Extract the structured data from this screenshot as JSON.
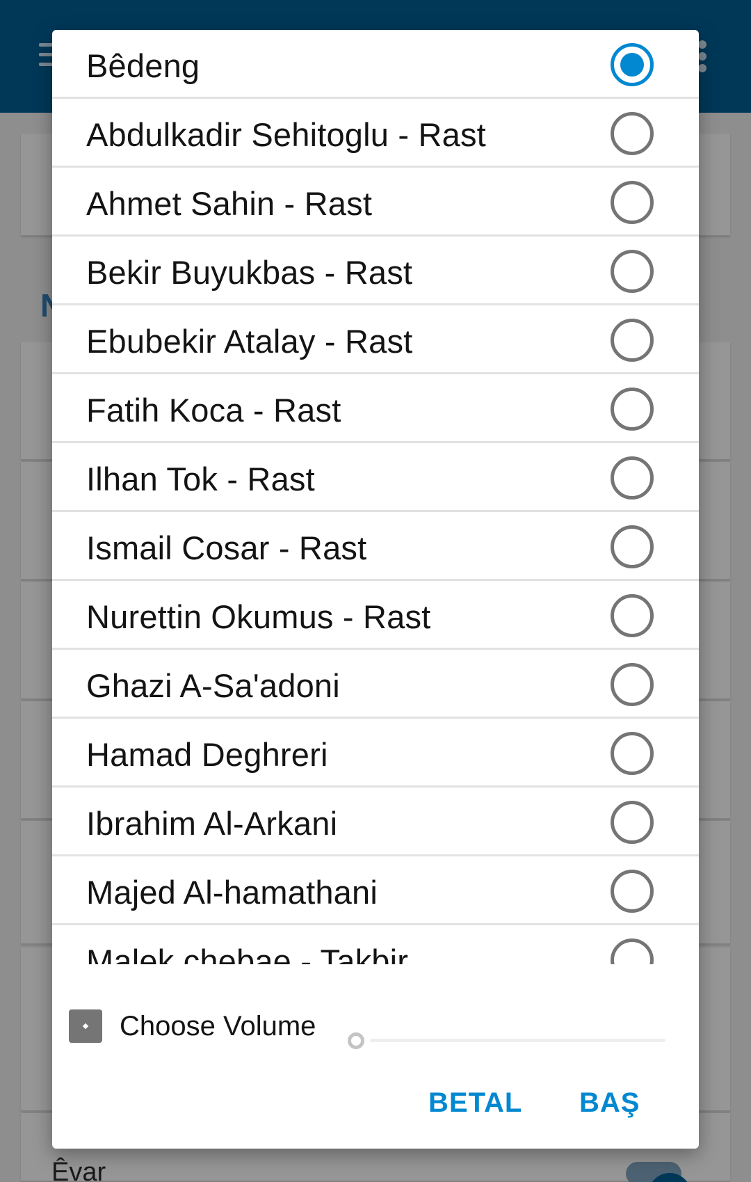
{
  "background": {
    "section_letter": "N",
    "footer_label": "Êvar"
  },
  "dialog": {
    "options": [
      {
        "label": "Bêdeng",
        "selected": true
      },
      {
        "label": "Abdulkadir Sehitoglu - Rast",
        "selected": false
      },
      {
        "label": "Ahmet Sahin - Rast",
        "selected": false
      },
      {
        "label": "Bekir Buyukbas - Rast",
        "selected": false
      },
      {
        "label": "Ebubekir Atalay - Rast",
        "selected": false
      },
      {
        "label": "Fatih Koca - Rast",
        "selected": false
      },
      {
        "label": "Ilhan Tok - Rast",
        "selected": false
      },
      {
        "label": "Ismail Cosar - Rast",
        "selected": false
      },
      {
        "label": "Nurettin Okumus - Rast",
        "selected": false
      },
      {
        "label": "Ghazi A-Sa'adoni",
        "selected": false
      },
      {
        "label": "Hamad Deghreri",
        "selected": false
      },
      {
        "label": "Ibrahim Al-Arkani",
        "selected": false
      },
      {
        "label": "Majed Al-hamathani",
        "selected": false
      },
      {
        "label": "Malek chebae - Takbir",
        "selected": false
      }
    ],
    "volume": {
      "label": "Choose Volume",
      "checked": false,
      "level": 0
    },
    "buttons": {
      "cancel": "BETAL",
      "ok": "BAŞ"
    }
  },
  "colors": {
    "app_bar": "#013858",
    "accent": "#0288d1",
    "radio_unchecked": "#757575"
  }
}
